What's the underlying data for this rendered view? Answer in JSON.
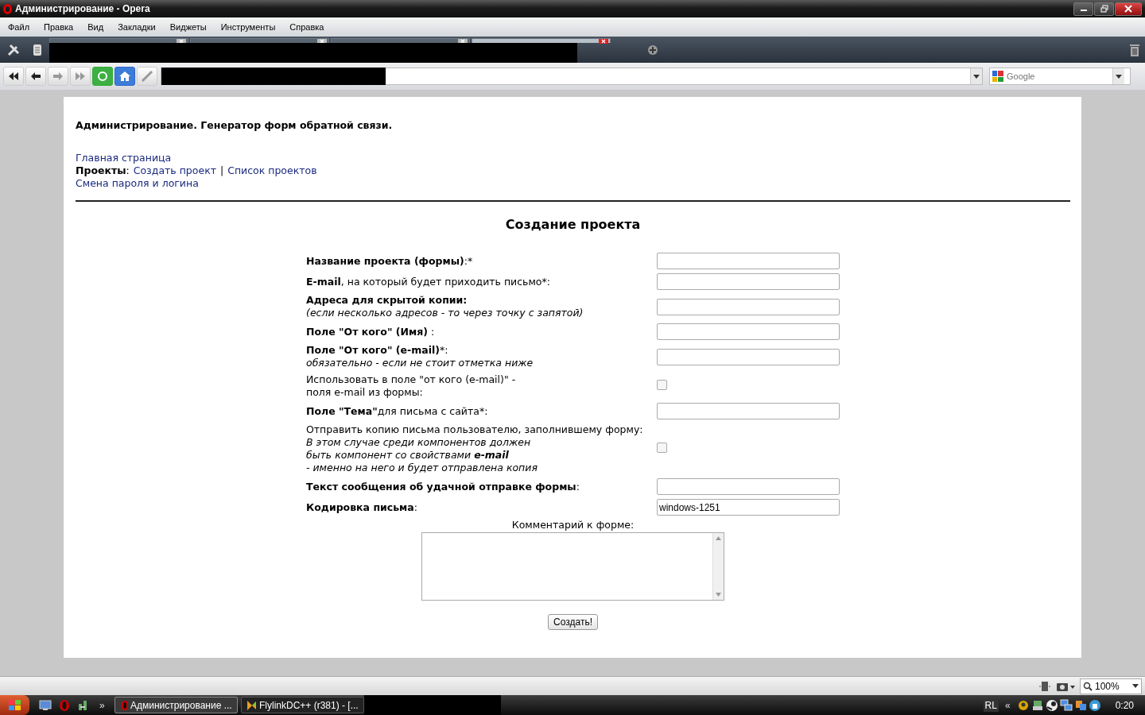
{
  "window": {
    "title": "Администрирование - Opera"
  },
  "menu": [
    "Файл",
    "Правка",
    "Вид",
    "Закладки",
    "Виджеты",
    "Инструменты",
    "Справка"
  ],
  "tabs": [
    {
      "selected": false
    },
    {
      "selected": false
    },
    {
      "selected": false
    },
    {
      "selected": true
    }
  ],
  "search": {
    "placeholder": "Google"
  },
  "page": {
    "header": "Администрирование. Генератор форм обратной связи.",
    "nav": [
      [
        {
          "text": "Главная страница",
          "kind": "link"
        }
      ],
      [
        {
          "text": "Проекты",
          "kind": "bold"
        },
        {
          "text": ":",
          "kind": "plain"
        },
        {
          "text": "Создать проект",
          "kind": "link"
        },
        {
          "text": "|",
          "kind": "plain"
        },
        {
          "text": "Список проектов",
          "kind": "link"
        }
      ],
      [
        {
          "text": "Смена пароля и логина",
          "kind": "link"
        }
      ]
    ],
    "heading": "Создание проекта",
    "form": [
      {
        "lines": [
          [
            {
              "text": "Название проекта (формы)",
              "kind": "bold"
            },
            {
              "text": ":*",
              "kind": "plain"
            }
          ]
        ],
        "control": {
          "kind": "text"
        }
      },
      {
        "lines": [
          [
            {
              "text": "E-mail",
              "kind": "bold"
            },
            {
              "text": ", на который будет приходить письмо*:",
              "kind": "plain"
            }
          ]
        ],
        "control": {
          "kind": "text"
        }
      },
      {
        "lines": [
          [
            {
              "text": "Адреса для скрытой копии:",
              "kind": "bold"
            }
          ],
          [
            {
              "text": "(если несколько адресов - то через точку с запятой)",
              "kind": "italic"
            }
          ]
        ],
        "control": {
          "kind": "text"
        }
      },
      {
        "lines": [
          [
            {
              "text": "Поле \"От кого\" (Имя)",
              "kind": "bold"
            },
            {
              "text": " :",
              "kind": "plain"
            }
          ]
        ],
        "control": {
          "kind": "text"
        }
      },
      {
        "lines": [
          [
            {
              "text": "Поле \"От кого\" (e-mail)",
              "kind": "bold"
            },
            {
              "text": "*:",
              "kind": "plain"
            }
          ],
          [
            {
              "text": "обязательно - если не стоит отметка ниже",
              "kind": "italic"
            }
          ]
        ],
        "control": {
          "kind": "text"
        }
      },
      {
        "lines": [
          [
            {
              "text": "Использовать в поле \"от кого (e-mail)\" -",
              "kind": "plain"
            }
          ],
          [
            {
              "text": "поля e-mail из формы:",
              "kind": "plain"
            }
          ]
        ],
        "control": {
          "kind": "checkbox",
          "checked": false
        }
      },
      {
        "lines": [
          [
            {
              "text": "Поле \"Тема\"",
              "kind": "bold"
            },
            {
              "text": "для письма с сайта*:",
              "kind": "plain"
            }
          ]
        ],
        "control": {
          "kind": "text"
        }
      },
      {
        "lines": [
          [
            {
              "text": "Отправить копию письма пользователю, заполнившему форму:",
              "kind": "plain"
            }
          ],
          [
            {
              "text": "В этом случае среди компонентов должен",
              "kind": "italic"
            }
          ],
          [
            {
              "text": "быть компонент со свойствами ",
              "kind": "italic"
            },
            {
              "text": "e-mail",
              "kind": "bold-italic"
            }
          ],
          [
            {
              "text": "- именно на него и будет отправлена копия",
              "kind": "italic"
            }
          ]
        ],
        "control": {
          "kind": "checkbox",
          "checked": false
        }
      },
      {
        "lines": [
          [
            {
              "text": "Текст сообщения об удачной отправке формы",
              "kind": "bold"
            },
            {
              "text": ":",
              "kind": "plain"
            }
          ]
        ],
        "control": {
          "kind": "text"
        }
      },
      {
        "lines": [
          [
            {
              "text": "Кодировка письма",
              "kind": "bold"
            },
            {
              "text": ":",
              "kind": "plain"
            }
          ]
        ],
        "control": {
          "kind": "text",
          "value": "windows-1251"
        }
      }
    ],
    "comment_label": "Комментарий к форме:",
    "submit": "Создать!"
  },
  "status_bar": {
    "zoom": "100%"
  },
  "taskbar": {
    "more": "»",
    "tasks": [
      {
        "label": "Администрирование ...",
        "selected": true
      },
      {
        "label": "FlylinkDC++ (r381) - [...",
        "selected": false
      }
    ],
    "language": "RL",
    "tray_toggle": "«",
    "clock": "0:20"
  }
}
